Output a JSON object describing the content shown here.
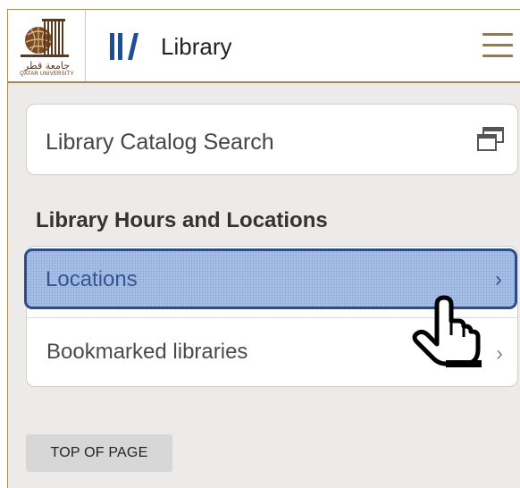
{
  "header": {
    "logo": {
      "arabic_text": "جامعة قطر",
      "english_text": "QATAR UNIVERSITY"
    },
    "app_icon": "library-books-icon",
    "title": "Library",
    "menu_icon": "hamburger-menu-icon"
  },
  "search": {
    "label": "Library Catalog Search",
    "icon": "new-window-icon"
  },
  "hours_section": {
    "heading": "Library Hours and Locations",
    "items": [
      {
        "label": "Locations",
        "icon": "chevron-right-icon",
        "state": "pressed"
      },
      {
        "label": "Bookmarked libraries",
        "icon": "chevron-right-icon"
      }
    ]
  },
  "footer": {
    "top_button_label": "TOP OF PAGE"
  },
  "colors": {
    "accent_brown": "#a88452",
    "highlight_fill": "#a9c1e8",
    "highlight_border": "#2c4d86",
    "icon_blue": "#1f4e96"
  }
}
